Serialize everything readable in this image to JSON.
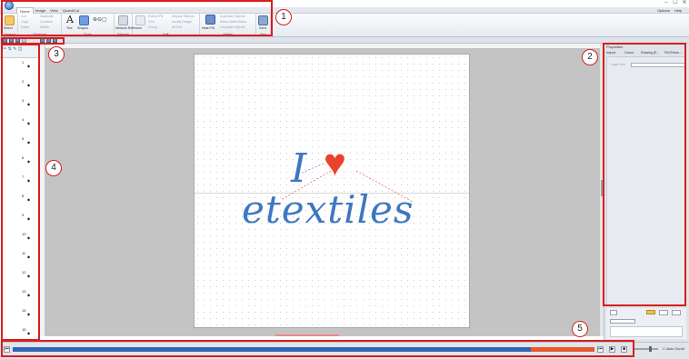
{
  "titlebar": {
    "minimize_glyph": "–",
    "maximize_glyph": "☐",
    "close_glyph": "✕"
  },
  "ribbon_tabs": [
    {
      "label": "Home",
      "active": true
    },
    {
      "label": "Image",
      "active": false
    },
    {
      "label": "View",
      "active": false
    },
    {
      "label": "QuantiCut",
      "active": false
    }
  ],
  "tabs_right": {
    "options_label": "Options",
    "help_label": "Help"
  },
  "ribbon": {
    "general": {
      "group_label": "General",
      "select_label": "Select"
    },
    "clipboard": {
      "group_label": "Clipboard",
      "items": [
        "Cut",
        "Copy",
        "Paste",
        "Duplicate",
        "Combine",
        "Delete"
      ]
    },
    "tools": {
      "group_label": "Tools",
      "text_label": "Text",
      "shapes_label": "Shapes"
    },
    "network": {
      "group_label": "Network",
      "label": "Network Refresher"
    },
    "edit": {
      "group_label": "Edit",
      "items": [
        "Extend Fill",
        "Trim",
        "Group",
        "Display Stitches",
        "Modify Design",
        "All Text"
      ]
    },
    "utilities": {
      "group_label": "Utilities",
      "heart_label": "Heart Fill",
      "items": [
        "Duplicate Objects",
        "Select Stitch Block",
        "Calculate Objects"
      ]
    },
    "sew": {
      "group_label": "Sew",
      "label": "Send"
    }
  },
  "left_panel": {
    "rows": [
      {
        "num": "1",
        "icon": "◆"
      },
      {
        "num": "2",
        "icon": "◆"
      },
      {
        "num": "3",
        "icon": "◆"
      },
      {
        "num": "4",
        "icon": "◆"
      },
      {
        "num": "5",
        "icon": "◆"
      },
      {
        "num": "6",
        "icon": "◆"
      },
      {
        "num": "7",
        "icon": "◆"
      },
      {
        "num": "8",
        "icon": "◆"
      },
      {
        "num": "9",
        "icon": "◆"
      },
      {
        "num": "10",
        "icon": "◆"
      },
      {
        "num": "11",
        "icon": "◆"
      },
      {
        "num": "12",
        "icon": "◆"
      },
      {
        "num": "13",
        "icon": "◆"
      },
      {
        "num": "14",
        "icon": "◆"
      },
      {
        "num": "15",
        "icon": "◆"
      }
    ]
  },
  "design": {
    "line1": "I",
    "heart": "♥",
    "line2": "etextiles",
    "text_color": "#3e77c1",
    "heart_color": "#e8432e"
  },
  "right_panel": {
    "title": "Properties",
    "tabs": [
      "Import",
      "Colors",
      "Drawing (E...",
      "Fill (Ficlan..."
    ],
    "field_label": "Layer",
    "field_label2": "Info"
  },
  "playback": {
    "progress_blue_fraction": 0.89,
    "progress_red_fraction": 0.11,
    "auto_scroll_label": "Auto Scroll",
    "rewind_glyph": "⏮",
    "play_glyph": "▶",
    "stop_glyph": "■"
  },
  "callouts": [
    {
      "number": "1"
    },
    {
      "number": "2"
    },
    {
      "number": "3"
    },
    {
      "number": "4"
    },
    {
      "number": "5"
    }
  ],
  "colors": {
    "accent_blue": "#2f66b3",
    "accent_red": "#e8582b",
    "callout_red": "#d81e1e"
  }
}
